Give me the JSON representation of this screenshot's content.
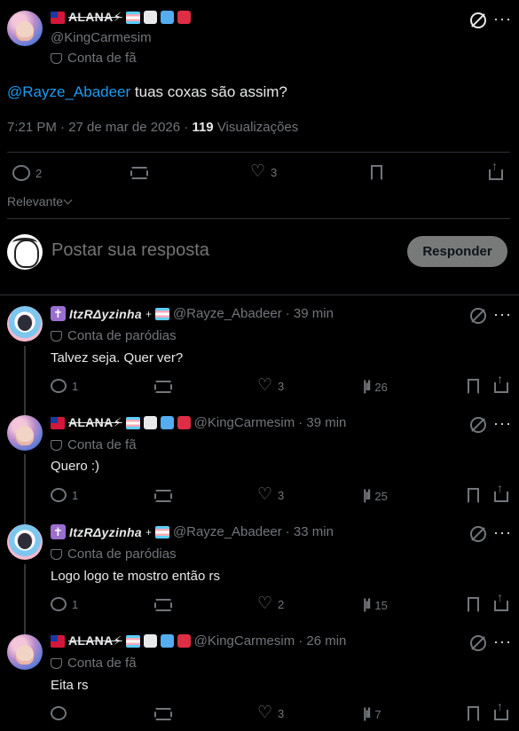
{
  "post": {
    "author": {
      "display_name": "ALANA⚡",
      "handle": "@KingCarmesim",
      "tag": "Conta de fã"
    },
    "mention": "@Rayze_Abadeer",
    "text": "tuas coxas são assim?",
    "time_date": "7:21 PM · 27 de mar de 2026 ·",
    "views_count": "119",
    "views_label": "Visualizações",
    "actions": {
      "replies": "2",
      "reposts": "",
      "likes": "3"
    }
  },
  "sort_label": "Relevante",
  "compose": {
    "placeholder": "Postar sua resposta",
    "button": "Responder"
  },
  "replies": [
    {
      "display_name": "ItzRΔyzinha",
      "handle": "@Rayze_Abadeer",
      "time": "· 39 min",
      "tag": "Conta de paródias",
      "text": "Talvez seja. Quer ver?",
      "replies": "1",
      "likes": "3",
      "views": "26"
    },
    {
      "display_name": "ALANA⚡",
      "handle": "@KingCarmesim",
      "time": "· 39 min",
      "tag": "Conta de fã",
      "text": "Quero :)",
      "replies": "1",
      "likes": "3",
      "views": "25"
    },
    {
      "display_name": "ItzRΔyzinha",
      "handle": "@Rayze_Abadeer",
      "time": "· 33 min",
      "tag": "Conta de paródias",
      "text": "Logo logo te mostro então rs",
      "replies": "1",
      "likes": "2",
      "views": "15"
    },
    {
      "display_name": "ALANA⚡",
      "handle": "@KingCarmesim",
      "time": "· 26 min",
      "tag": "Conta de fã",
      "text": "Eita rs",
      "replies": "",
      "likes": "3",
      "views": "7"
    }
  ],
  "icons": [
    "grok-icon",
    "more-icon",
    "reply-icon",
    "repost-icon",
    "like-icon",
    "bookmark-icon",
    "share-icon",
    "views-icon",
    "chevron-down-icon",
    "parody-mask-icon"
  ],
  "colors": {
    "background": "#000000",
    "text": "#e7e9ea",
    "muted": "#71767b",
    "link": "#1d9bf0",
    "button": "#787a7a",
    "divider": "#2f3336"
  }
}
